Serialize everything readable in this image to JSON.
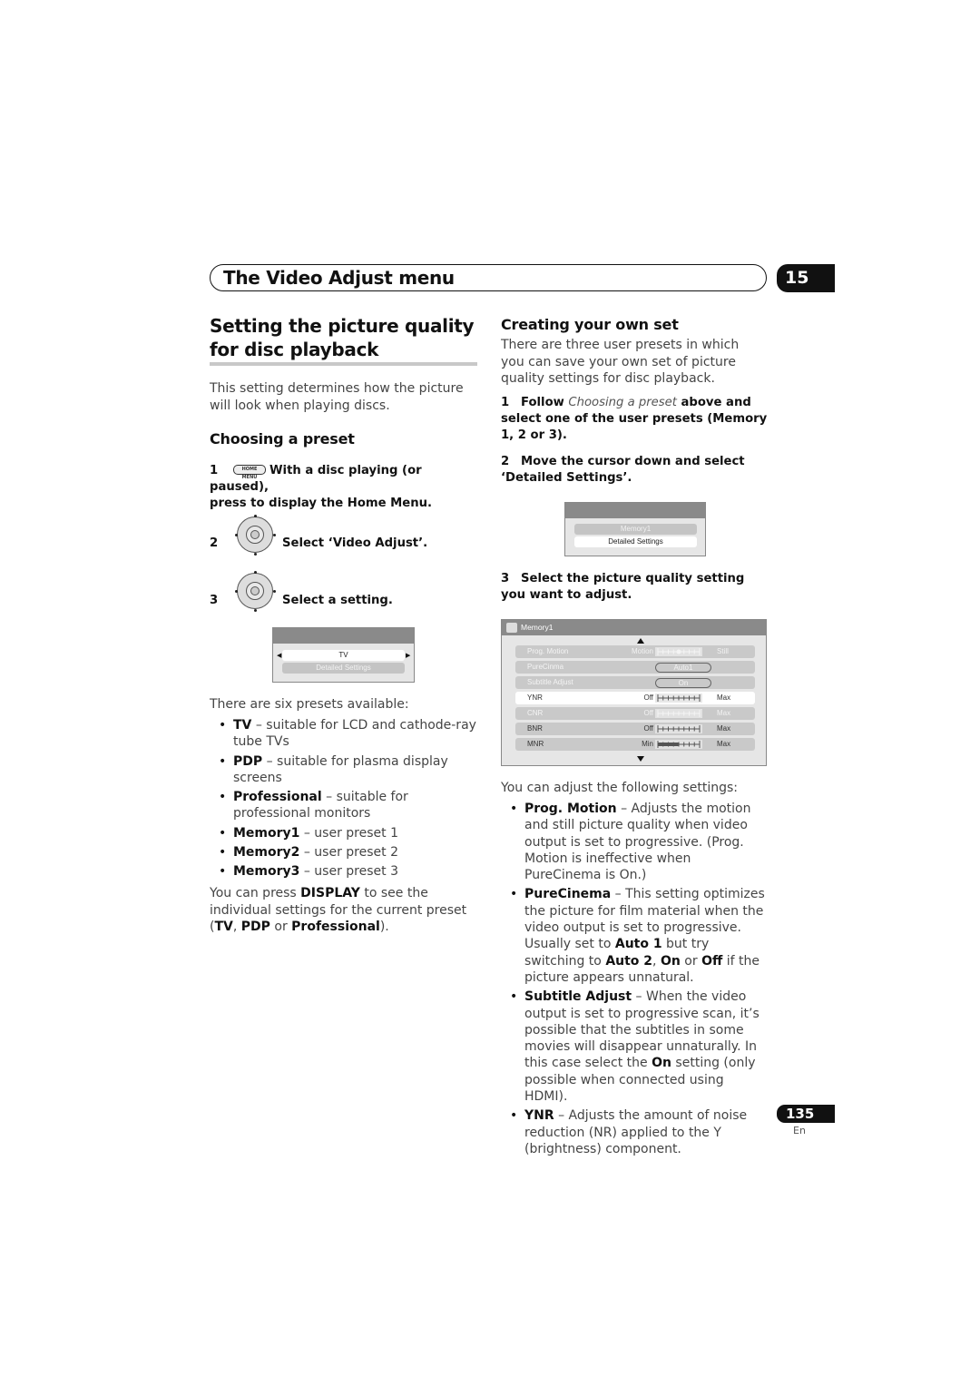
{
  "header": {
    "chapter_title": "The Video Adjust menu",
    "chapter_number": "15"
  },
  "left": {
    "section_title_line1": "Setting the picture quality",
    "section_title_line2": "for disc playback",
    "intro": "This setting determines how the picture will look when playing discs.",
    "subsection_title": "Choosing a preset",
    "steps": [
      {
        "num": "1",
        "button_label": "HOME MENU",
        "text_line1": "With a disc playing (or paused),",
        "text_line2": "press to display the Home Menu."
      },
      {
        "num": "2",
        "icon": "enter-dial-icon",
        "text": "Select ‘Video Adjust’."
      },
      {
        "num": "3",
        "icon": "enter-dial-icon",
        "text": "Select a setting."
      }
    ],
    "preset_menu": {
      "selected_value": "TV",
      "item": "Detailed Settings",
      "left_arrow": "◀",
      "right_arrow": "▶"
    },
    "presets_intro": "There are six presets available:",
    "presets": [
      {
        "name": "TV",
        "desc": " – suitable for LCD and cathode-ray tube TVs"
      },
      {
        "name": "PDP",
        "desc": " – suitable for plasma display screens"
      },
      {
        "name": "Professional",
        "desc": " – suitable for professional monitors"
      },
      {
        "name": "Memory1",
        "desc": " – user preset 1"
      },
      {
        "name": "Memory2",
        "desc": " – user preset 2"
      },
      {
        "name": "Memory3",
        "desc": " – user preset 3"
      }
    ],
    "display_note": {
      "t1": "You can press ",
      "b1": "DISPLAY",
      "t2": " to see the individual settings for the current preset (",
      "b2": "TV",
      "t3": ", ",
      "b3": "PDP",
      "t4": " or ",
      "b4": "Professional",
      "t5": ")."
    }
  },
  "right": {
    "subsection_title": "Creating your own set",
    "intro": "There are three user presets in which you can save your own set of picture quality settings for disc playback.",
    "step1": {
      "num": "1",
      "b1": "Follow ",
      "i": "Choosing a preset",
      "b2": " above and select one of the user presets (Memory 1, 2 or 3)."
    },
    "step2": {
      "num": "2",
      "text": "Move the cursor down and select ‘Detailed Settings’."
    },
    "memory_menu": {
      "item1": "Memory1",
      "item2": "Detailed Settings"
    },
    "step3": {
      "num": "3",
      "text": "Select the picture quality setting you want to adjust."
    },
    "settings_menu": {
      "title": "Memory1",
      "rows": [
        {
          "label": "Prog. Motion",
          "type": "slider",
          "low": "Motion",
          "high": "Still",
          "value_fraction": 0.5,
          "dim": true
        },
        {
          "label": "PureCinma",
          "type": "pill",
          "value": "Auto1",
          "dim": true
        },
        {
          "label": "Subtitle Adjust",
          "type": "pill",
          "value": "On",
          "dim": true
        },
        {
          "label": "YNR",
          "type": "slider",
          "low": "Off",
          "high": "Max",
          "value_fraction": 0,
          "selected": true
        },
        {
          "label": "CNR",
          "type": "slider",
          "low": "Off",
          "high": "Max",
          "value_fraction": 0,
          "dim": true
        },
        {
          "label": "BNR",
          "type": "slider",
          "low": "Off",
          "high": "Max",
          "value_fraction": 0
        },
        {
          "label": "MNR",
          "type": "slider",
          "low": "Min",
          "high": "Max",
          "value_fraction": 0.5,
          "filled": true
        }
      ]
    },
    "adjust_intro": "You can adjust the following settings:",
    "settings": [
      {
        "name": "Prog. Motion",
        "desc": " – Adjusts the motion and still picture quality when video output is set to progressive. (Prog. Motion is ineffective when PureCinema is On.)"
      },
      {
        "name": "PureCinema",
        "desc_parts": [
          " – This setting optimizes the picture for film material when the video output is set to progressive. Usually set to ",
          "Auto 1",
          " but try switching to ",
          "Auto 2",
          ", ",
          "On",
          " or ",
          "Off",
          " if the picture appears unnatural."
        ]
      },
      {
        "name": "Subtitle Adjust",
        "desc_parts": [
          " – When the video output is set to progressive scan, it’s possible that the subtitles in some movies will disappear unnaturally. In this case select the ",
          "On",
          " setting (only possible when connected using HDMI)."
        ]
      },
      {
        "name": "YNR",
        "desc": " – Adjusts the amount of noise reduction (NR) applied to the Y (brightness) component."
      }
    ]
  },
  "footer": {
    "page_number": "135",
    "language": "En"
  }
}
